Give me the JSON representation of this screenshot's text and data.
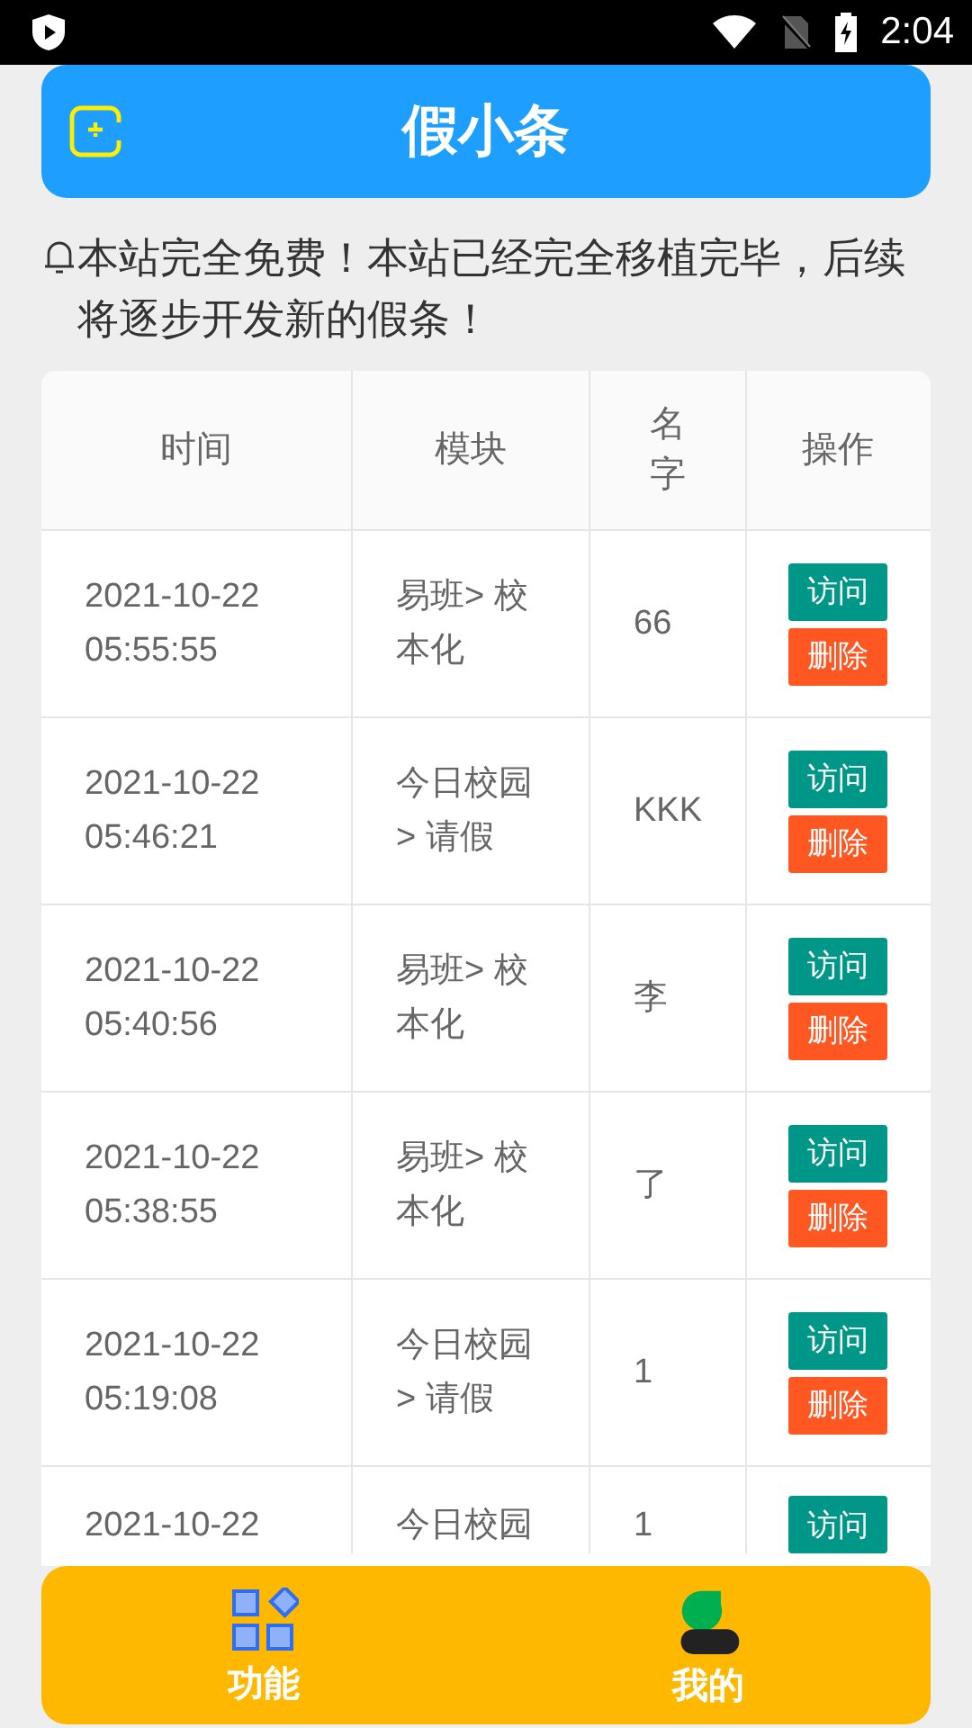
{
  "status_bar": {
    "time": "2:04"
  },
  "header": {
    "title": "假小条"
  },
  "notice": "本站完全免费！本站已经完全移植完毕，后续将逐步开发新的假条！",
  "table": {
    "columns": [
      "时间",
      "模块",
      "名字",
      "操作"
    ],
    "rows": [
      {
        "time": "2021-10-22 05:55:55",
        "module": "易班> 校本化",
        "name": "66",
        "actions": [
          "访问",
          "删除"
        ]
      },
      {
        "time": "2021-10-22 05:46:21",
        "module": "今日校园 > 请假",
        "name": "KKK",
        "actions": [
          "访问",
          "删除"
        ]
      },
      {
        "time": "2021-10-22 05:40:56",
        "module": "易班> 校本化",
        "name": "李",
        "actions": [
          "访问",
          "删除"
        ]
      },
      {
        "time": "2021-10-22 05:38:55",
        "module": "易班> 校本化",
        "name": "了",
        "actions": [
          "访问",
          "删除"
        ]
      },
      {
        "time": "2021-10-22 05:19:08",
        "module": "今日校园 > 请假",
        "name": "1",
        "actions": [
          "访问",
          "删除"
        ]
      },
      {
        "time": "2021-10-22",
        "module": "今日校园",
        "name": "1",
        "actions": [
          "访问"
        ],
        "partial": true
      }
    ]
  },
  "bottom_nav": [
    {
      "kind": "features",
      "label": "功能"
    },
    {
      "kind": "profile",
      "label": "我的"
    }
  ]
}
